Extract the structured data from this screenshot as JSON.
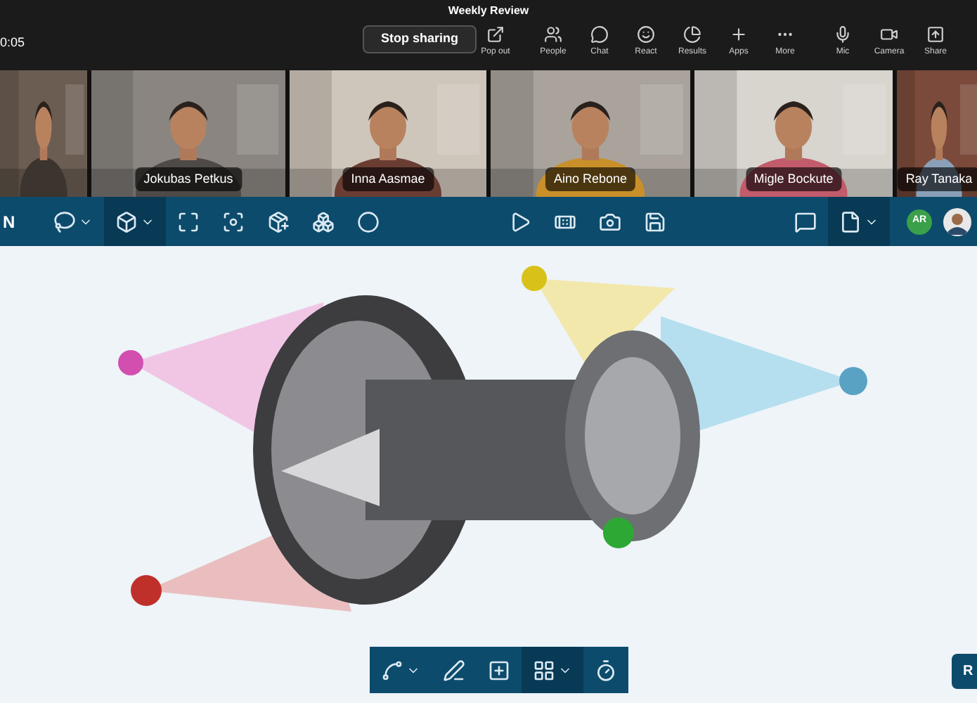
{
  "window": {
    "title": "Weekly Review"
  },
  "meeting": {
    "timer": "0:05",
    "stop_sharing": "Stop sharing"
  },
  "actions": [
    {
      "label": "Pop out"
    },
    {
      "label": "People"
    },
    {
      "label": "Chat"
    },
    {
      "label": "React"
    },
    {
      "label": "Results"
    },
    {
      "label": "Apps"
    },
    {
      "label": "More"
    },
    {
      "label": "Mic"
    },
    {
      "label": "Camera"
    },
    {
      "label": "Share"
    }
  ],
  "participants": [
    {
      "name": "Jokubas Petkus"
    },
    {
      "name": "Inna Aasmae"
    },
    {
      "name": "Aino Rebone"
    },
    {
      "name": "Migle Bockute"
    },
    {
      "name": "Ray Tanaka"
    }
  ],
  "toolbar": {
    "app_letter": "N",
    "tools": [
      {
        "selected": false,
        "dropdown": true
      },
      {
        "selected": true,
        "dropdown": true
      },
      {
        "selected": false,
        "dropdown": false
      },
      {
        "selected": false,
        "dropdown": false
      },
      {
        "selected": false,
        "dropdown": false
      },
      {
        "selected": false,
        "dropdown": false
      },
      {
        "selected": false,
        "dropdown": false
      },
      {
        "selected": false,
        "dropdown": false
      },
      {
        "selected": false,
        "dropdown": false
      },
      {
        "selected": false,
        "dropdown": false
      },
      {
        "selected": false,
        "dropdown": false
      },
      {
        "selected": false,
        "dropdown": false
      },
      {
        "selected": true,
        "dropdown": true
      }
    ],
    "avatar_initials": "AR"
  },
  "bottom_tools": [
    {
      "selected": false,
      "dropdown": true
    },
    {
      "selected": false,
      "dropdown": false
    },
    {
      "selected": false,
      "dropdown": false
    },
    {
      "selected": true,
      "dropdown": true
    },
    {
      "selected": false,
      "dropdown": false
    }
  ],
  "corner_button": "R"
}
